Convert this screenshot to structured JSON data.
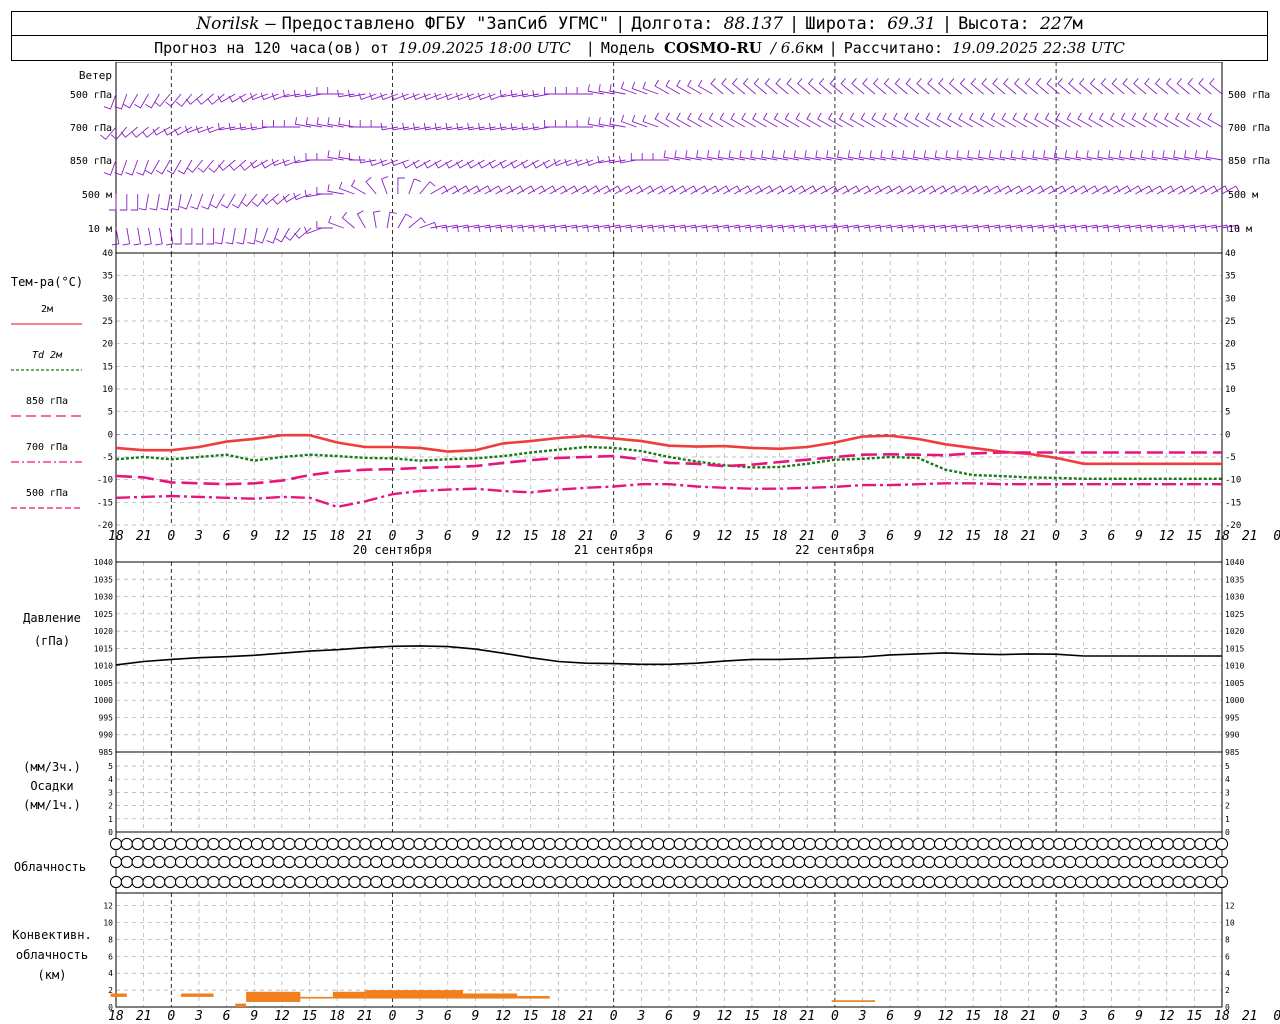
{
  "header": {
    "station": "Norilsk",
    "dash": "–",
    "provider": "Предоставлено ФГБУ \"ЗапСиб УГМС\"",
    "lon_label": "Долгота:",
    "lon_value": "88.137",
    "lat_label": "Широта:",
    "lat_value": "69.31",
    "alt_label": "Высота:",
    "alt_value": "227",
    "alt_unit": "м",
    "forecast_prefix": "Прогноз на 120 часа(ов) от",
    "forecast_from": "19.09.2025 18:00 UTC",
    "model_label": "Модель",
    "model_name": "COSMO-RU",
    "model_res": "/ 6.6",
    "model_res_unit": "км",
    "computed_label": "Рассчитано:",
    "computed_value": "19.09.2025 22:38 UTC"
  },
  "wind_panel": {
    "title": "Ветер",
    "levels": [
      "500 гПа",
      "700 гПа",
      "850 гПа",
      "500 м",
      "10  м"
    ],
    "colors": {
      "barb": "#8a1ec8"
    },
    "directions": [
      [
        200,
        200,
        210,
        210,
        210,
        220,
        220,
        220,
        230,
        230,
        230,
        240,
        240,
        240,
        250,
        250,
        250,
        260,
        260,
        260,
        270,
        270,
        260,
        260,
        250,
        250,
        250,
        250,
        250,
        250,
        250,
        250,
        250,
        250,
        250,
        250,
        250,
        260,
        260,
        260,
        260,
        270,
        270,
        270,
        270,
        280,
        280,
        280,
        290,
        290,
        290,
        300,
        300,
        300,
        300,
        300,
        310,
        310,
        310,
        310,
        310,
        310,
        310,
        310,
        310,
        310,
        310,
        310,
        310,
        310,
        310,
        310,
        310,
        310,
        310,
        310,
        310,
        310,
        310,
        310,
        310,
        310,
        310,
        310,
        310,
        310,
        310,
        310,
        310,
        310,
        310,
        310,
        310,
        310,
        310,
        310,
        310,
        310,
        310,
        310,
        310,
        310,
        310
      ],
      [
        220,
        220,
        230,
        230,
        230,
        240,
        240,
        240,
        250,
        250,
        250,
        260,
        260,
        260,
        260,
        270,
        270,
        270,
        280,
        280,
        280,
        280,
        280,
        270,
        270,
        270,
        260,
        260,
        260,
        260,
        260,
        260,
        260,
        260,
        260,
        260,
        260,
        260,
        260,
        260,
        260,
        270,
        270,
        270,
        270,
        280,
        280,
        280,
        290,
        290,
        290,
        300,
        300,
        300,
        300,
        300,
        300,
        300,
        300,
        300,
        300,
        300,
        300,
        300,
        300,
        300,
        300,
        300,
        300,
        300,
        300,
        300,
        300,
        300,
        300,
        300,
        300,
        300,
        300,
        300,
        300,
        300,
        300,
        300,
        300,
        300,
        300,
        300,
        300,
        300,
        300,
        300,
        300,
        300,
        300,
        300,
        300,
        300,
        300,
        300,
        300,
        300,
        300
      ],
      [
        200,
        200,
        200,
        200,
        210,
        210,
        210,
        210,
        220,
        220,
        220,
        230,
        230,
        230,
        240,
        240,
        250,
        250,
        260,
        270,
        270,
        280,
        280,
        270,
        260,
        250,
        250,
        250,
        240,
        240,
        240,
        240,
        240,
        240,
        240,
        240,
        240,
        240,
        240,
        240,
        240,
        240,
        250,
        250,
        250,
        250,
        260,
        260,
        260,
        270,
        270,
        270,
        280,
        280,
        280,
        280,
        280,
        280,
        280,
        280,
        280,
        280,
        280,
        280,
        280,
        280,
        280,
        280,
        280,
        280,
        280,
        280,
        280,
        280,
        280,
        280,
        280,
        280,
        280,
        280,
        280,
        280,
        280,
        280,
        280,
        280,
        280,
        280,
        280,
        280,
        280,
        280,
        280,
        280,
        280,
        280,
        280,
        280,
        280,
        280,
        280,
        280,
        280
      ],
      [
        180,
        180,
        180,
        190,
        190,
        190,
        190,
        200,
        200,
        200,
        210,
        210,
        210,
        220,
        220,
        230,
        230,
        240,
        250,
        260,
        270,
        280,
        290,
        300,
        320,
        340,
        0,
        20,
        40,
        60,
        60,
        60,
        60,
        60,
        60,
        60,
        60,
        60,
        60,
        60,
        60,
        60,
        60,
        60,
        60,
        60,
        60,
        60,
        60,
        60,
        60,
        60,
        60,
        60,
        60,
        60,
        60,
        60,
        60,
        60,
        60,
        60,
        60,
        60,
        60,
        60,
        60,
        60,
        60,
        60,
        60,
        60,
        60,
        60,
        60,
        60,
        60,
        60,
        60,
        60,
        60,
        60,
        60,
        60,
        60,
        60,
        60,
        60,
        60,
        60,
        60,
        60,
        60,
        60,
        60,
        60,
        60,
        60,
        60,
        60,
        60,
        60,
        60
      ],
      [
        170,
        170,
        170,
        170,
        170,
        170,
        180,
        180,
        180,
        180,
        190,
        190,
        190,
        190,
        200,
        200,
        210,
        220,
        230,
        250,
        270,
        290,
        310,
        330,
        350,
        10,
        30,
        50,
        70,
        80,
        80,
        80,
        80,
        80,
        80,
        80,
        80,
        80,
        80,
        80,
        80,
        80,
        80,
        80,
        80,
        80,
        80,
        80,
        80,
        80,
        80,
        80,
        80,
        80,
        80,
        80,
        80,
        80,
        80,
        80,
        80,
        80,
        80,
        80,
        80,
        80,
        80,
        80,
        80,
        80,
        80,
        80,
        80,
        80,
        80,
        80,
        80,
        80,
        80,
        80,
        80,
        80,
        80,
        80,
        80,
        80,
        80,
        80,
        80,
        80,
        80,
        80,
        80,
        80,
        80,
        80,
        80,
        80,
        80,
        80,
        80,
        80,
        80
      ]
    ]
  },
  "time_axis": {
    "hour_labels": [
      "18",
      "21",
      "0",
      "3",
      "6",
      "9",
      "12",
      "15",
      "18",
      "21",
      "0",
      "3",
      "6",
      "9",
      "12",
      "15",
      "18",
      "21",
      "0",
      "3",
      "6",
      "9",
      "12",
      "15",
      "18",
      "21",
      "0",
      "3",
      "6",
      "9",
      "12",
      "15",
      "18",
      "21",
      "0",
      "3",
      "6",
      "9",
      "12",
      "15",
      "18",
      "21",
      "0"
    ],
    "day_labels": [
      "20 сентября",
      "21 сентября",
      "22 сентября"
    ]
  },
  "temperature_panel": {
    "title": "Тем-ра(°C)",
    "legend": [
      {
        "label": "2м",
        "color": "#f03c3c",
        "style": "solid"
      },
      {
        "label_prefix": "Td",
        "label": "2м",
        "color": "#1a7a1a",
        "style": "dotted"
      },
      {
        "label": "850 гПа",
        "color": "#e8147e",
        "style": "dash"
      },
      {
        "label": "700 гПа",
        "color": "#e8147e",
        "style": "dashdot"
      },
      {
        "label": "500 гПа",
        "color": "#e8147e",
        "style": "longdash"
      }
    ],
    "ytick_labels": [
      "40",
      "35",
      "30",
      "25",
      "20",
      "15",
      "10",
      "5",
      "0",
      "-5",
      "-10",
      "-15",
      "-20"
    ]
  },
  "pressure_panel": {
    "title": "Давление",
    "unit": "(гПа)",
    "ytick_labels": [
      "1040",
      "1035",
      "1030",
      "1025",
      "1020",
      "1015",
      "1010",
      "1005",
      "1000",
      "995",
      "990",
      "985"
    ]
  },
  "precip_panel": {
    "unit_top": "(мм/3ч.)",
    "title": "Осадки",
    "unit_bottom": "(мм/1ч.)",
    "ytick_labels": [
      "5",
      "4",
      "3",
      "2",
      "1",
      "0"
    ]
  },
  "cloud_panel": {
    "title": "Облачность",
    "rows": [
      [
        0,
        0,
        0,
        0,
        0,
        0,
        0,
        0,
        0,
        0,
        0,
        0,
        0,
        0,
        0,
        0,
        0,
        0,
        0,
        0,
        0,
        0,
        0,
        0,
        0,
        0,
        0,
        0,
        0,
        0,
        0,
        0,
        0,
        0,
        0,
        0,
        0,
        0,
        0,
        0,
        0,
        0,
        0,
        0,
        0,
        0,
        0,
        0,
        0,
        0,
        0,
        0,
        0,
        0,
        0,
        0,
        0,
        0,
        0,
        0,
        0,
        0,
        0,
        0,
        0,
        0,
        0,
        0,
        0,
        0,
        0,
        0,
        0,
        0,
        0,
        0,
        0,
        0,
        0,
        0,
        0,
        0,
        0,
        0,
        0,
        0,
        0,
        0,
        0,
        0,
        0,
        0,
        0,
        0,
        0,
        0,
        0,
        0,
        0,
        0,
        0,
        0,
        0
      ],
      [
        0,
        0,
        0,
        0,
        0,
        0,
        0,
        0,
        0,
        0,
        0,
        0,
        0,
        0,
        0,
        0,
        0,
        0,
        0,
        0,
        0,
        0,
        0,
        0,
        0,
        0,
        0,
        0,
        0,
        0,
        0,
        0,
        0,
        0,
        0,
        0,
        0,
        0,
        0,
        0,
        0,
        0,
        0,
        0,
        0,
        0,
        0,
        0,
        0,
        0,
        0,
        0,
        0,
        0,
        0,
        0,
        0,
        0,
        0,
        0,
        0,
        0,
        0,
        0,
        0,
        0,
        0,
        0,
        0,
        0,
        0,
        0,
        0,
        0,
        0,
        0,
        0,
        0,
        0,
        0,
        0,
        0,
        0,
        0,
        0,
        0,
        0,
        0,
        0,
        0,
        0,
        0,
        0,
        0,
        0,
        0,
        0,
        0,
        0,
        0,
        0,
        0,
        0
      ],
      [
        0,
        0,
        0,
        0,
        0,
        0,
        0,
        0,
        0,
        0,
        0,
        0,
        0,
        0,
        0,
        0,
        0,
        0,
        0,
        0,
        0,
        0,
        0,
        0,
        0,
        0,
        0,
        0,
        0,
        0,
        0,
        0,
        0,
        0,
        0,
        0,
        0,
        0,
        0,
        0,
        0,
        0,
        0,
        0,
        0,
        0,
        0,
        0,
        0,
        0,
        0,
        0,
        0,
        0,
        0,
        0,
        0,
        0,
        0,
        0,
        0,
        0,
        0,
        0,
        0,
        0,
        0,
        0,
        0,
        0,
        0,
        0,
        0,
        0,
        0,
        0,
        0,
        0,
        0,
        0,
        0,
        0,
        0,
        0,
        0,
        0,
        0,
        0,
        0,
        0,
        0,
        0,
        0,
        0,
        0,
        0,
        0,
        0,
        0,
        0,
        0,
        0,
        0
      ]
    ]
  },
  "convective_panel": {
    "title_lines": [
      "Конвективн.",
      "облачность",
      "(км)"
    ],
    "ytick_labels": [
      "12",
      "10",
      "8",
      "6",
      "4",
      "2",
      "0"
    ],
    "color": "#f07f1e",
    "bars": [
      {
        "x0": -0.5,
        "x1": 1.0,
        "base": 1.2,
        "top": 1.6
      },
      {
        "x0": 6.0,
        "x1": 9.0,
        "base": 1.2,
        "top": 1.6
      },
      {
        "x0": 11.0,
        "x1": 12.0,
        "base": 0.0,
        "top": 0.4
      },
      {
        "x0": 12.0,
        "x1": 17.0,
        "base": 0.6,
        "top": 1.8
      },
      {
        "x0": 17.0,
        "x1": 20.0,
        "base": 1.0,
        "top": 1.2
      },
      {
        "x0": 20.0,
        "x1": 23.0,
        "base": 1.0,
        "top": 1.8
      },
      {
        "x0": 23.0,
        "x1": 32.0,
        "base": 1.0,
        "top": 2.0
      },
      {
        "x0": 32.0,
        "x1": 37.0,
        "base": 1.0,
        "top": 1.6
      },
      {
        "x0": 37.0,
        "x1": 40.0,
        "base": 1.0,
        "top": 1.3
      },
      {
        "x0": 66.0,
        "x1": 70.0,
        "base": 0.6,
        "top": 0.8
      }
    ]
  },
  "chart_data": {
    "type": "line",
    "x_hours": [
      0,
      3,
      6,
      9,
      12,
      15,
      18,
      21,
      24,
      27,
      30,
      33,
      36,
      39,
      42,
      45,
      48,
      51,
      54,
      57,
      60,
      63,
      66,
      69,
      72,
      75,
      78,
      81,
      84,
      87,
      90,
      93,
      96,
      99,
      102,
      105,
      108,
      111,
      114,
      117,
      120
    ],
    "x_start": "19.09.2025 18:00 UTC",
    "x_unit": "час",
    "temperature": {
      "ylim": [
        -20,
        40
      ],
      "series": [
        {
          "name": "2м",
          "values": [
            -3.0,
            -3.5,
            -3.5,
            -2.8,
            -1.6,
            -1.0,
            -0.2,
            -0.2,
            -1.8,
            -2.8,
            -2.8,
            -3.0,
            -3.8,
            -3.5,
            -2.0,
            -1.5,
            -0.8,
            -0.4,
            -0.9,
            -1.5,
            -2.5,
            -2.7,
            -2.6,
            -3.0,
            -3.2,
            -2.8,
            -1.8,
            -0.5,
            -0.3,
            -1.0,
            -2.2,
            -3.0,
            -3.8,
            -4.3,
            -5.2,
            -6.5,
            -6.5,
            -6.5,
            -6.5,
            -6.5,
            -6.5
          ]
        },
        {
          "name": "Td 2м",
          "values": [
            -5.5,
            -5.0,
            -5.5,
            -5.0,
            -4.5,
            -5.8,
            -5.0,
            -4.5,
            -4.8,
            -5.2,
            -5.3,
            -5.8,
            -5.5,
            -5.3,
            -4.8,
            -4.0,
            -3.4,
            -2.8,
            -3.0,
            -3.7,
            -5.0,
            -6.0,
            -6.8,
            -7.3,
            -7.2,
            -6.5,
            -5.6,
            -5.4,
            -5.0,
            -5.2,
            -7.8,
            -9.0,
            -9.2,
            -9.5,
            -9.6,
            -9.8,
            -9.8,
            -9.8,
            -9.8,
            -9.8,
            -9.8
          ]
        },
        {
          "name": "850 гПа",
          "values": [
            -9.2,
            -9.5,
            -10.6,
            -10.8,
            -11.0,
            -10.8,
            -10.2,
            -9.0,
            -8.2,
            -7.8,
            -7.7,
            -7.4,
            -7.2,
            -7.0,
            -6.3,
            -5.7,
            -5.2,
            -5.0,
            -4.8,
            -5.5,
            -6.3,
            -6.5,
            -7.0,
            -6.7,
            -6.1,
            -5.6,
            -5.0,
            -4.5,
            -4.4,
            -4.5,
            -4.6,
            -4.2,
            -4.0,
            -4.0,
            -4.0,
            -4.0,
            -4.0,
            -4.0,
            -4.0,
            -4.0,
            -4.0
          ]
        },
        {
          "name": "700 гПа",
          "values": [
            -14.0,
            -13.8,
            -13.6,
            -13.8,
            -14.0,
            -14.2,
            -13.8,
            -14.0,
            -16.0,
            -14.8,
            -13.2,
            -12.5,
            -12.2,
            -12.0,
            -12.5,
            -12.8,
            -12.2,
            -11.8,
            -11.5,
            -11.0,
            -11.0,
            -11.5,
            -11.8,
            -12.0,
            -12.0,
            -11.8,
            -11.6,
            -11.2,
            -11.2,
            -11.0,
            -10.8,
            -10.8,
            -11.0,
            -11.0,
            -11.0,
            -11.0,
            -11.0,
            -11.0,
            -11.0,
            -11.0,
            -11.0
          ]
        }
      ]
    },
    "pressure": {
      "ylim": [
        985,
        1040
      ],
      "series": [
        {
          "name": "Давление",
          "values": [
            1010.2,
            1011.2,
            1011.8,
            1012.3,
            1012.6,
            1013.0,
            1013.6,
            1014.2,
            1014.6,
            1015.2,
            1015.6,
            1015.7,
            1015.5,
            1014.8,
            1013.6,
            1012.3,
            1011.2,
            1010.7,
            1010.6,
            1010.4,
            1010.4,
            1010.7,
            1011.3,
            1011.8,
            1011.8,
            1012.0,
            1012.3,
            1012.5,
            1013.1,
            1013.4,
            1013.7,
            1013.4,
            1013.2,
            1013.4,
            1013.3,
            1012.8,
            1012.8,
            1012.8,
            1012.8,
            1012.8,
            1012.8
          ]
        }
      ]
    },
    "precipitation": {
      "ylim": [
        0,
        5
      ],
      "values": []
    }
  }
}
